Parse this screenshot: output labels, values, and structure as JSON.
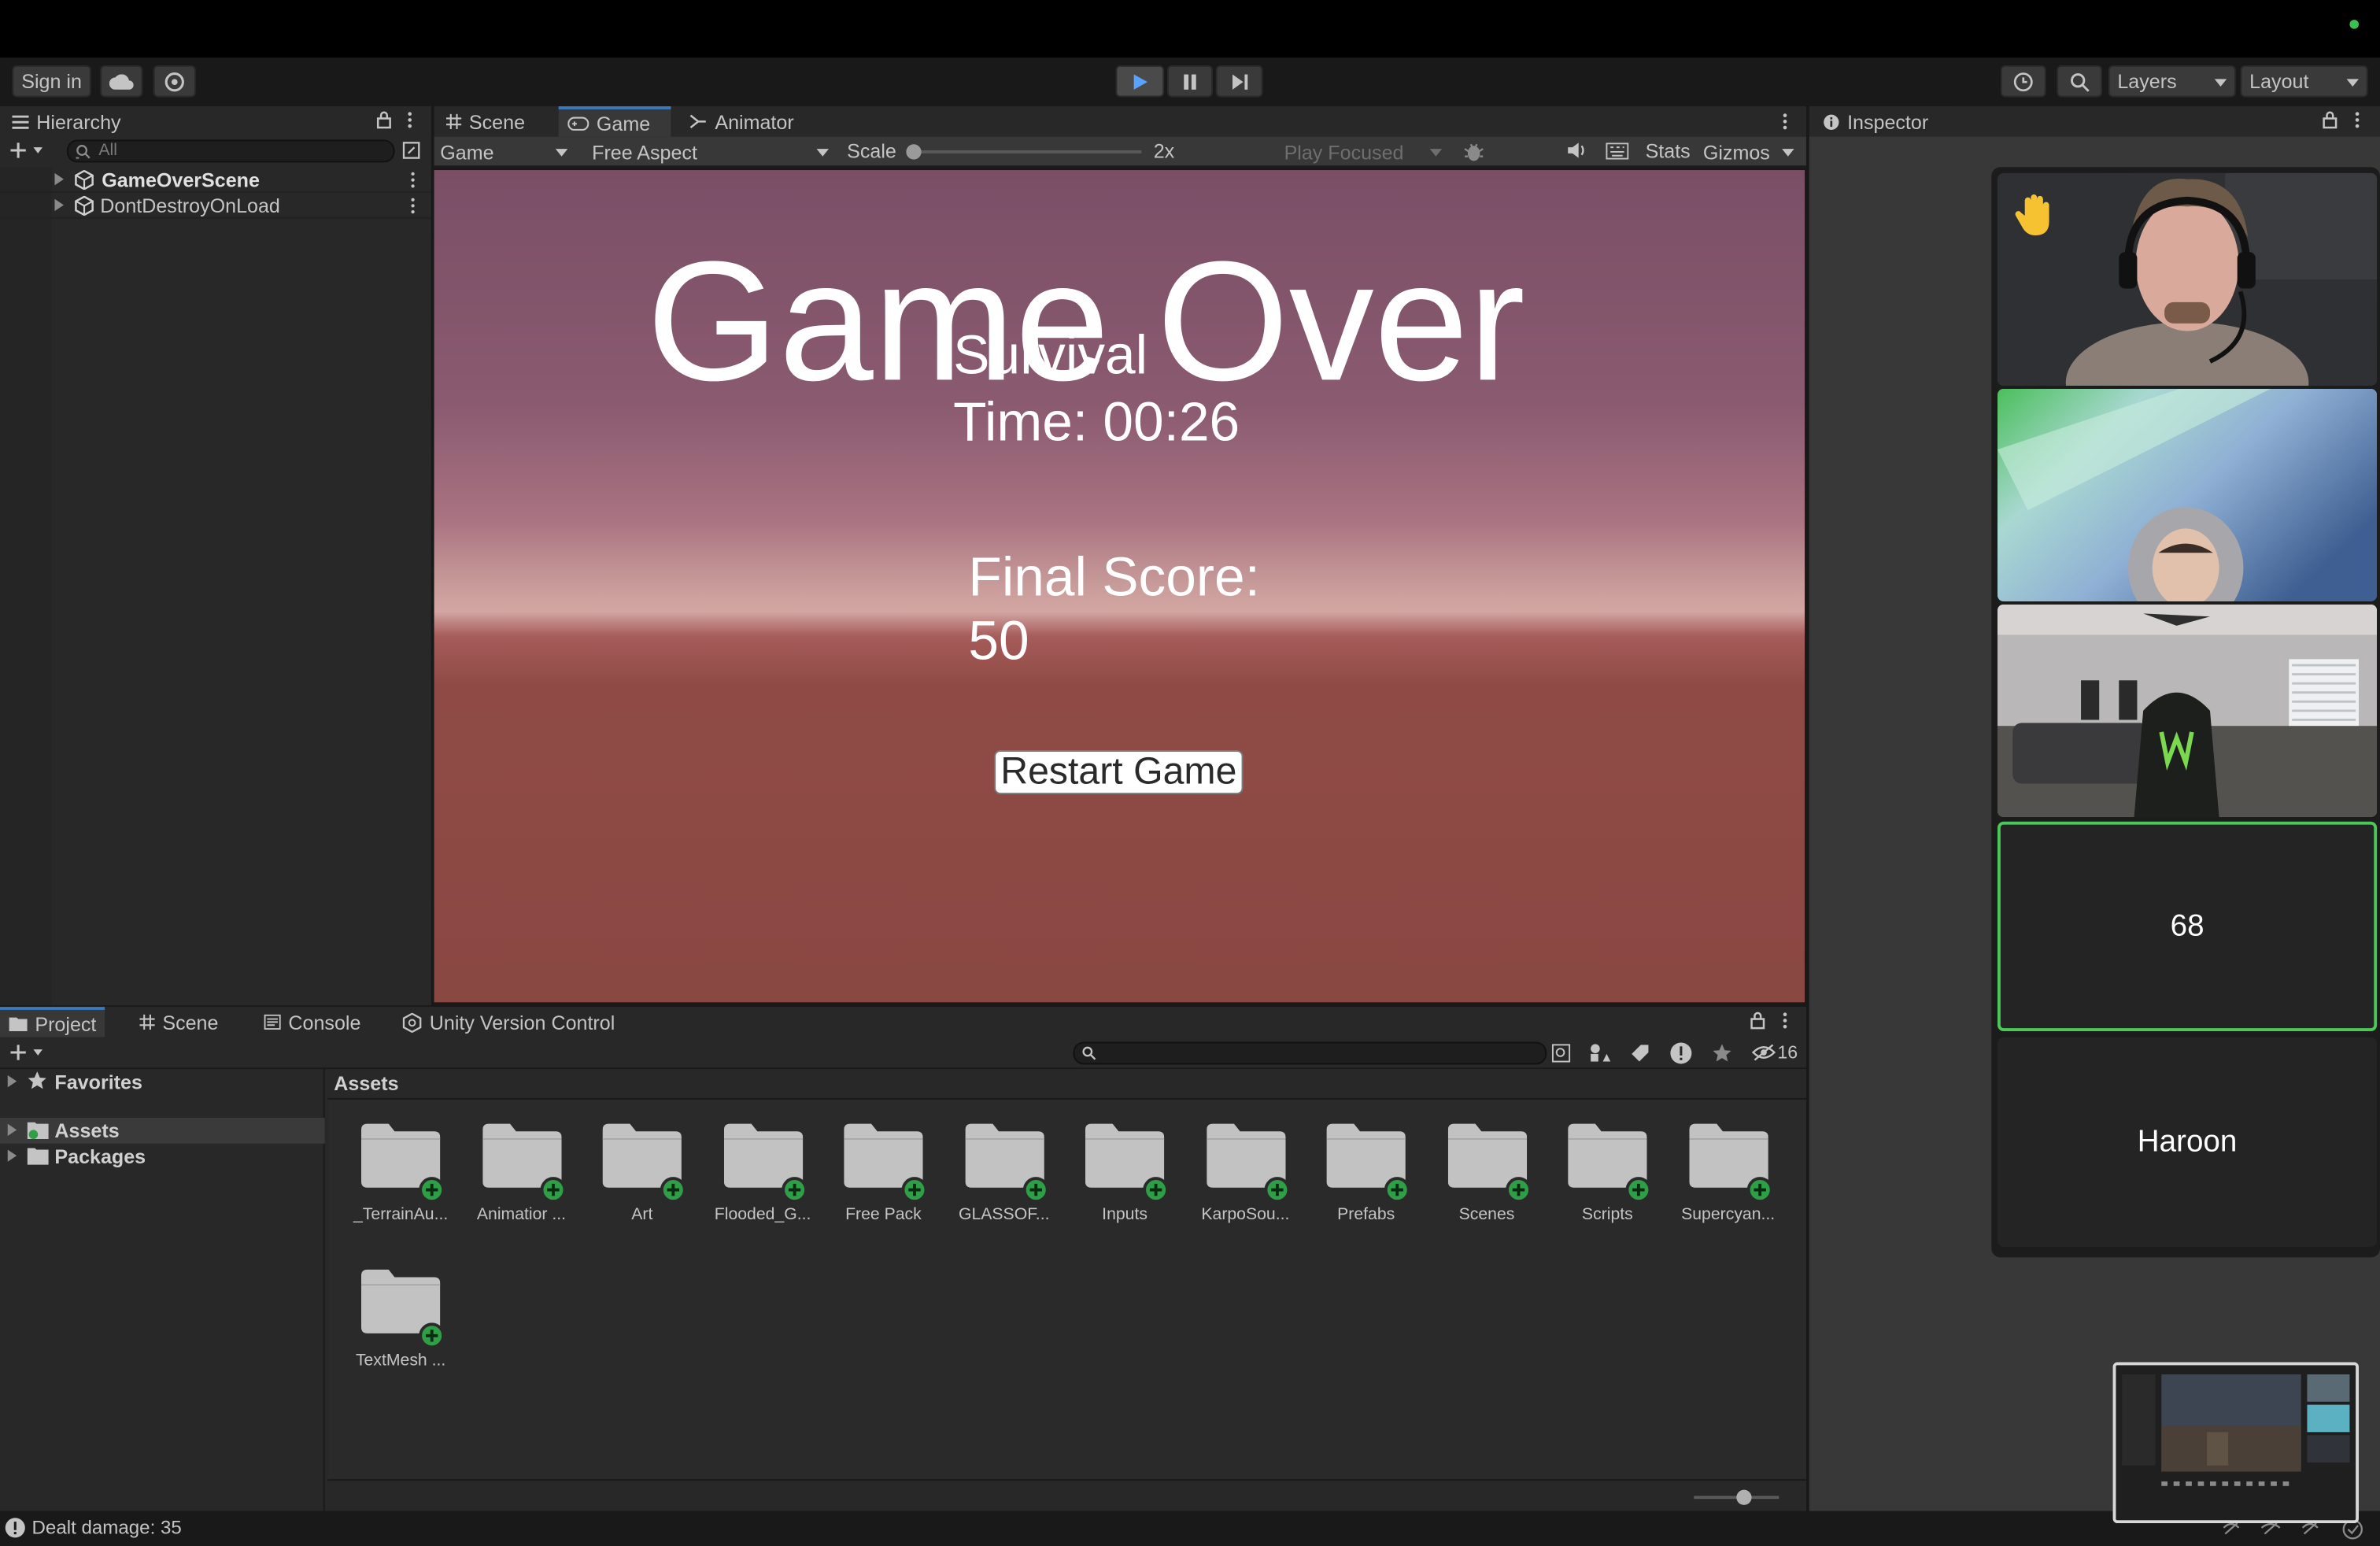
{
  "toolbar": {
    "sign_in": "Sign in",
    "layers": "Layers",
    "layout": "Layout"
  },
  "hierarchy": {
    "title": "Hierarchy",
    "search_placeholder": "All",
    "items": [
      {
        "label": "GameOverScene"
      },
      {
        "label": "DontDestroyOnLoad"
      }
    ]
  },
  "center_tabs": [
    {
      "label": "Scene"
    },
    {
      "label": "Game"
    },
    {
      "label": "Animator"
    }
  ],
  "game_toolbar": {
    "display": "Game",
    "aspect": "Free Aspect",
    "scale_label": "Scale",
    "scale_value": "2x",
    "scale_fraction": 0.0,
    "play_mode": "Play Focused",
    "stats": "Stats",
    "gizmos": "Gizmos"
  },
  "game_view": {
    "title": "Game Over",
    "survival_label": "Survival",
    "time_text": "Time: 00:26",
    "score_label": "Final Score:",
    "score_value": "50",
    "restart_button": "Restart Game"
  },
  "inspector": {
    "title": "Inspector"
  },
  "bottom_tabs": [
    {
      "label": "Project"
    },
    {
      "label": "Scene"
    },
    {
      "label": "Console"
    },
    {
      "label": "Unity Version Control"
    }
  ],
  "project": {
    "hidden_count": "16",
    "tree": [
      {
        "label": "Favorites"
      },
      {
        "label": "Assets"
      },
      {
        "label": "Packages"
      }
    ],
    "breadcrumb": "Assets",
    "folders": [
      {
        "label": "_TerrainAu..."
      },
      {
        "label": "Animatior ..."
      },
      {
        "label": "Art"
      },
      {
        "label": "Flooded_G..."
      },
      {
        "label": "Free Pack"
      },
      {
        "label": "GLASSOF..."
      },
      {
        "label": "Inputs"
      },
      {
        "label": "KarpoSou..."
      },
      {
        "label": "Prefabs"
      },
      {
        "label": "Scenes"
      },
      {
        "label": "Scripts"
      },
      {
        "label": "Supercyan..."
      },
      {
        "label": "TextMesh ..."
      }
    ]
  },
  "status_bar": {
    "message": "Dealt damage: 35"
  },
  "call": {
    "participants": [
      {
        "type": "video",
        "scene": "person-headset",
        "raised_hand": true
      },
      {
        "type": "video",
        "scene": "person-hoodie"
      },
      {
        "type": "video",
        "scene": "room-gaming-chair"
      },
      {
        "type": "avatar",
        "label": "68",
        "speaking": true
      },
      {
        "type": "avatar",
        "label": "Haroon"
      }
    ]
  },
  "colors": {
    "accent": "#3a79bb",
    "speaking_border": "#4cc75a",
    "add_badge": "#2e9e47",
    "game_sky_top": "#7a4f66",
    "game_ground": "#8c4a44"
  }
}
